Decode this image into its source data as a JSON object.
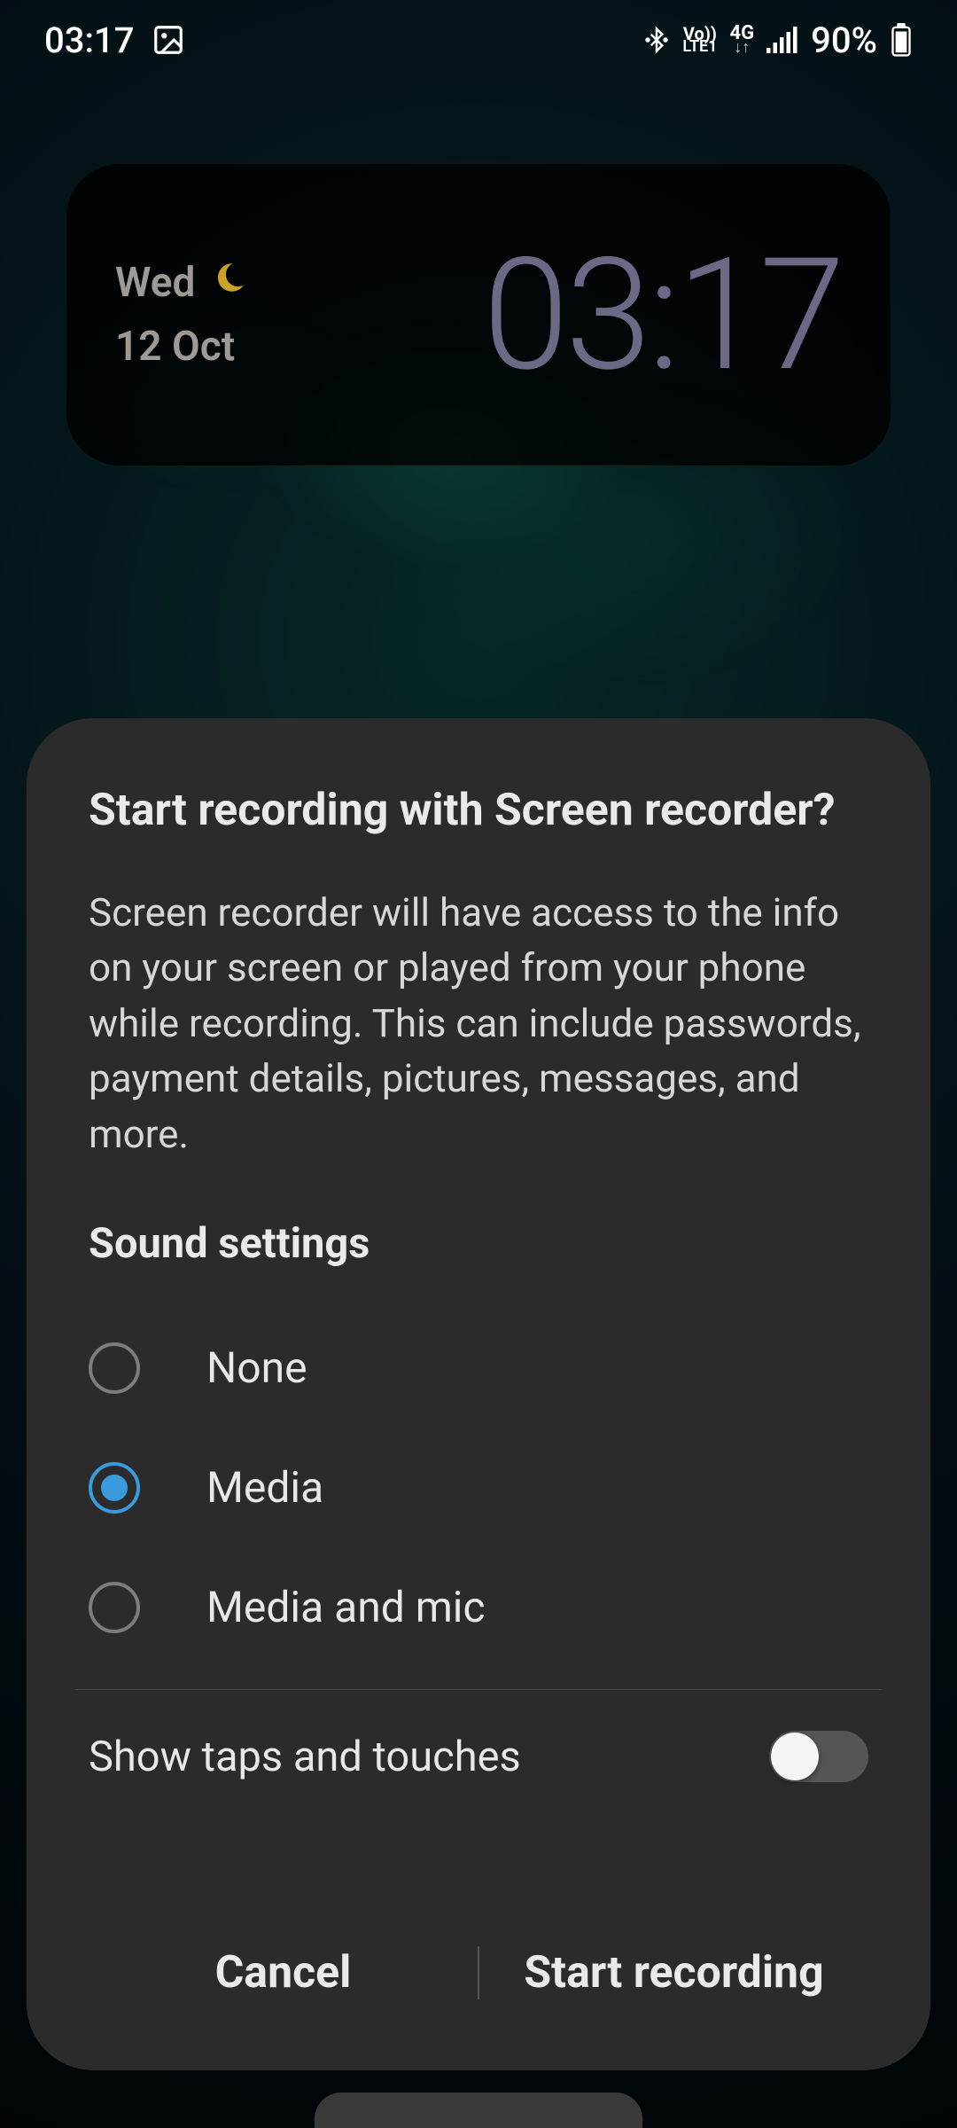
{
  "status": {
    "time": "03:17",
    "volte_top": "Vo))",
    "volte_bottom": "LTE1",
    "network": "4G",
    "battery": "90%"
  },
  "widget": {
    "day": "Wed",
    "date": "12 Oct",
    "time": "03:17"
  },
  "dialog": {
    "title": "Start recording with Screen recorder?",
    "body": "Screen recorder will have access to the info on your screen or played from your phone while recording. This can include passwords, payment details, pictures, messages, and more.",
    "sound_section": "Sound settings",
    "options": [
      {
        "label": "None",
        "selected": false
      },
      {
        "label": "Media",
        "selected": true
      },
      {
        "label": "Media and mic",
        "selected": false
      }
    ],
    "toggle": {
      "label": "Show taps and touches",
      "on": false
    },
    "cancel": "Cancel",
    "start": "Start recording"
  }
}
